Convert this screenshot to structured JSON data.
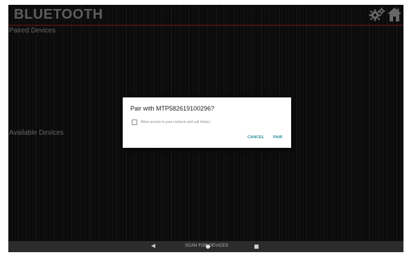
{
  "header": {
    "title": "BLUETOOTH",
    "settings_icon": "gear-icon",
    "home_icon": "home-icon",
    "accent_color": "#8a1c1c"
  },
  "sections": {
    "paired_label": "Paired Devices",
    "available_label": "Available Devices"
  },
  "dialog": {
    "title": "Pair with MTP582619100296?",
    "checkbox_label": "Allow access to your contacts and call history",
    "checkbox_checked": false,
    "cancel_label": "CANCEL",
    "pair_label": "PAIR",
    "button_color": "#1f8c94"
  },
  "navbar": {
    "scan_label": "SCAN FOR DEVICES",
    "back_icon": "back-triangle-icon",
    "home_icon": "home-circle-icon",
    "recents_icon": "recents-square-icon"
  }
}
